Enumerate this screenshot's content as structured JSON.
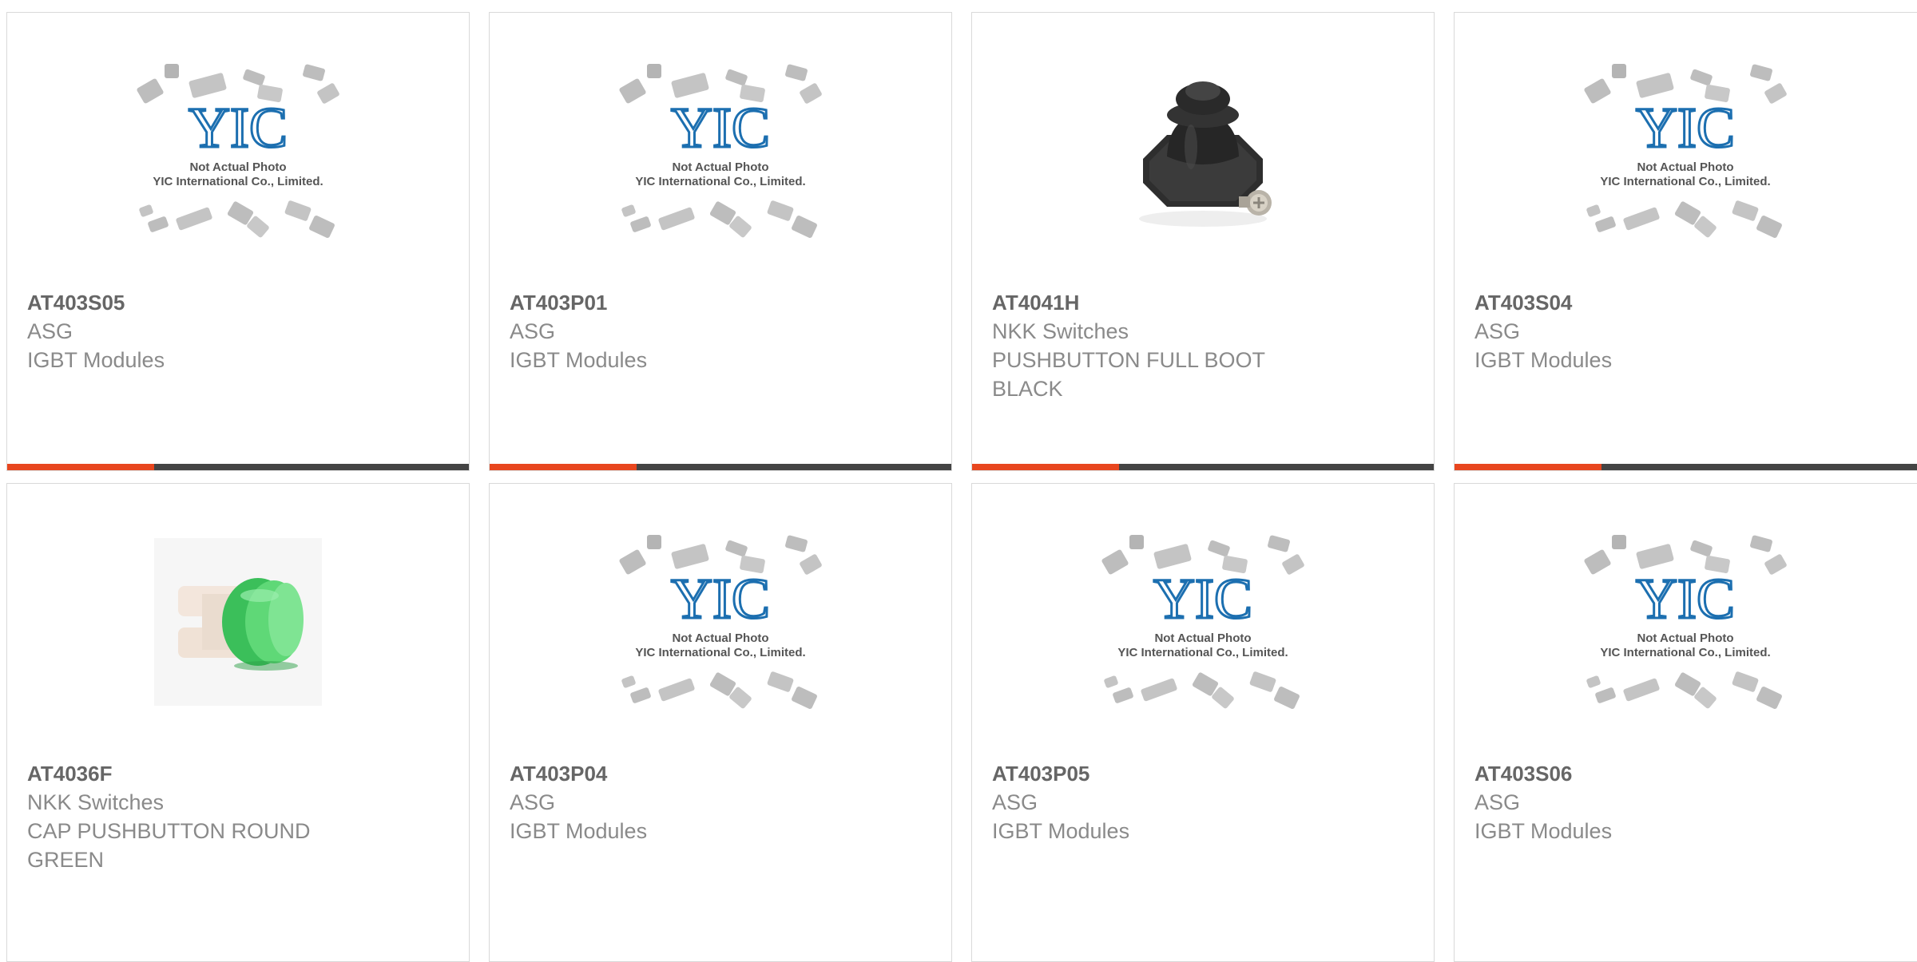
{
  "placeholder": {
    "logo_text": "YIC",
    "line1": "Not Actual Photo",
    "line2": "YIC International Co., Limited."
  },
  "colors": {
    "accent": "#e8461e",
    "bar": "#444444",
    "logo": "#1c6fb0",
    "chip": "#b4b4b4"
  },
  "products": [
    {
      "part": "AT403S05",
      "mfr": "ASG",
      "desc": "IGBT Modules",
      "image": "placeholder"
    },
    {
      "part": "AT403P01",
      "mfr": "ASG",
      "desc": "IGBT Modules",
      "image": "placeholder"
    },
    {
      "part": "AT4041H",
      "mfr": "NKK Switches",
      "desc": "PUSHBUTTON FULL BOOT BLACK",
      "image": "black-boot-photo"
    },
    {
      "part": "AT403S04",
      "mfr": "ASG",
      "desc": "IGBT Modules",
      "image": "placeholder"
    },
    {
      "part": "AT4036F",
      "mfr": "NKK Switches",
      "desc": "CAP PUSHBUTTON ROUND GREEN",
      "image": "green-cap-photo"
    },
    {
      "part": "AT403P04",
      "mfr": "ASG",
      "desc": "IGBT Modules",
      "image": "placeholder"
    },
    {
      "part": "AT403P05",
      "mfr": "ASG",
      "desc": "IGBT Modules",
      "image": "placeholder"
    },
    {
      "part": "AT403S06",
      "mfr": "ASG",
      "desc": "IGBT Modules",
      "image": "placeholder"
    }
  ]
}
